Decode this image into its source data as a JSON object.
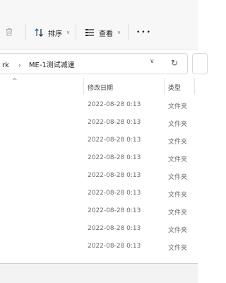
{
  "toolbar": {
    "sort_label": "排序",
    "view_label": "查看",
    "more_label": "•••"
  },
  "address": {
    "path_partial": "rk",
    "folder": "ME-1测试减速"
  },
  "columns": {
    "modified": "修改日期",
    "type": "类型"
  },
  "rows": [
    {
      "date": "2022-08-28 0:13",
      "type": "文件夹"
    },
    {
      "date": "2022-08-28 0:13",
      "type": "文件夹"
    },
    {
      "date": "2022-08-28 0:13",
      "type": "文件夹"
    },
    {
      "date": "2022-08-28 0:13",
      "type": "文件夹"
    },
    {
      "date": "2022-08-28 0:13",
      "type": "文件夹"
    },
    {
      "date": "2022-08-28 0:13",
      "type": "文件夹"
    },
    {
      "date": "2022-08-28 0:13",
      "type": "文件夹"
    },
    {
      "date": "2022-08-28 0:13",
      "type": "文件夹"
    },
    {
      "date": "2022-08-28 0:13",
      "type": "文件夹"
    }
  ]
}
